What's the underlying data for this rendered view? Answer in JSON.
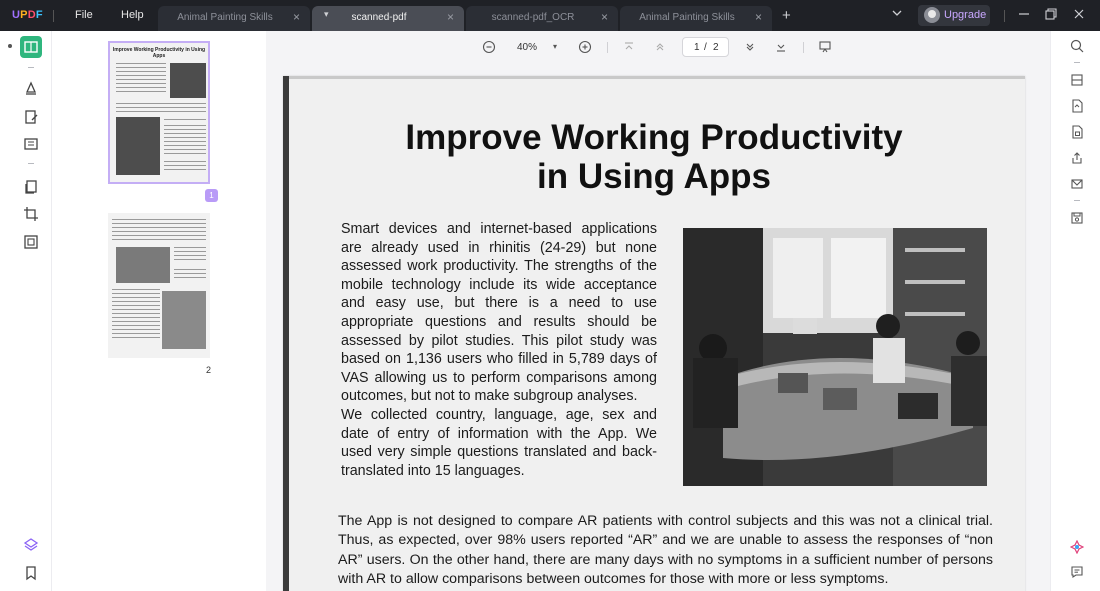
{
  "app": {
    "logo": [
      "U",
      "P",
      "D",
      "F"
    ],
    "menu": {
      "file": "File",
      "help": "Help"
    },
    "tabs": [
      {
        "label": "Animal Painting Skills",
        "active": false
      },
      {
        "label": "scanned-pdf",
        "active": true
      },
      {
        "label": "scanned-pdf_OCR",
        "active": false
      },
      {
        "label": "Animal Painting Skills",
        "active": false
      }
    ],
    "tab_close_glyph": "×",
    "tab_add_glyph": "+",
    "upgrade_label": "Upgrade",
    "accent_color": "#a071ff"
  },
  "toolbar": {
    "zoom": "40%",
    "current_page": "1",
    "separator": "/",
    "total_pages": "2"
  },
  "thumbnails": {
    "page1_title": "Improve Working Productivity in Using Apps",
    "page1_label": "1",
    "page2_label": "2"
  },
  "document": {
    "title_line1": "Improve Working Productivity",
    "title_line2": "in Using Apps",
    "paragraph1": "Smart devices and internet-based applications are already used in rhinitis (24-29) but none assessed work productivity. The strengths of the mobile technology include its wide acceptance and easy use, but there is a need to use appropriate questions and results should be assessed by pilot studies. This pilot study was based on 1,136 users who filled in 5,789 days of VAS allowing us to perform comparisons among outcomes, but not to make subgroup analyses.",
    "paragraph2": "We collected country, language, age, sex and date of entry of information with the App. We used very simple questions translated and back-translated into 15 languages.",
    "paragraph3": "The App is not designed to compare AR patients with control subjects and this was not a clinical trial. Thus, as expected, over 98% users reported “AR” and we are unable to assess the responses of “non AR” users. On the other hand, there are many days with no symptoms in a sufficient number of persons with AR to allow comparisons between outcomes for those with more or less symptoms."
  }
}
